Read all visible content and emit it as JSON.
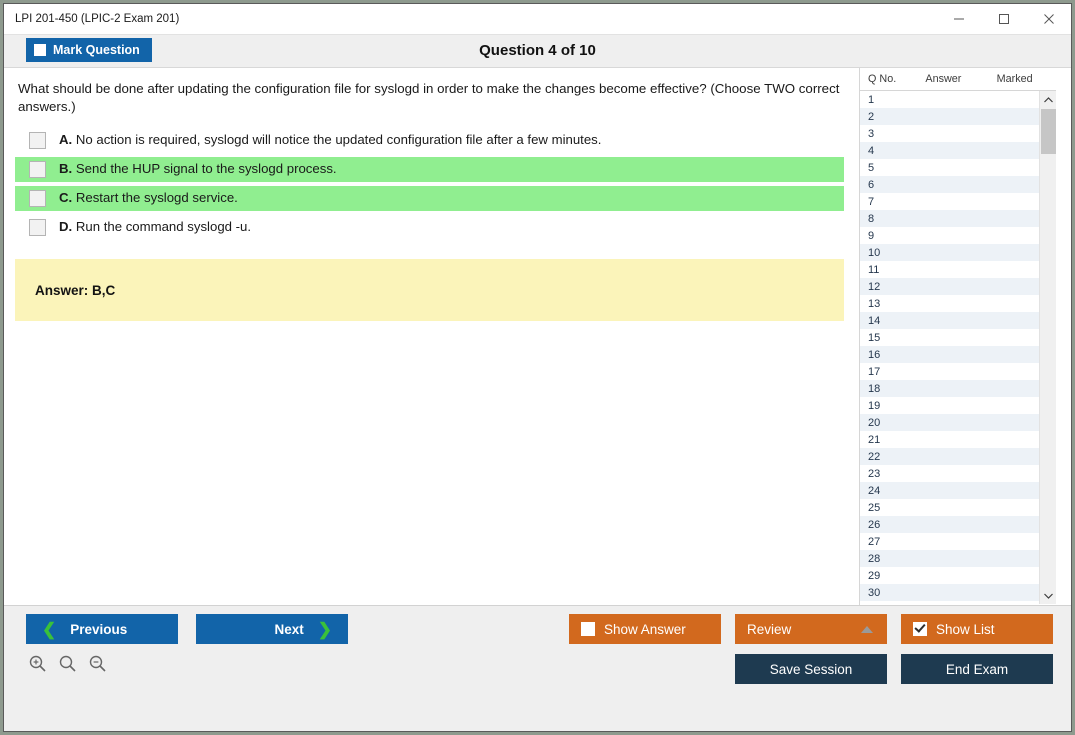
{
  "window": {
    "title": "LPI 201-450 (LPIC-2 Exam 201)",
    "minimize_label": "minimize",
    "maximize_label": "maximize",
    "close_label": "close"
  },
  "toolbar": {
    "mark_question_label": "Mark Question",
    "question_counter": "Question 4 of 10"
  },
  "question": {
    "text": "What should be done after updating the configuration file for syslogd in order to make the changes become effective? (Choose TWO correct answers.)",
    "options": [
      {
        "letter": "A.",
        "text": "No action is required, syslogd will notice the updated configuration file after a few minutes.",
        "correct": false
      },
      {
        "letter": "B.",
        "text": "Send the HUP signal to the syslogd process.",
        "correct": true
      },
      {
        "letter": "C.",
        "text": "Restart the syslogd service.",
        "correct": true
      },
      {
        "letter": "D.",
        "text": "Run the command syslogd -u.",
        "correct": false
      }
    ],
    "answer_label": "Answer: B,C"
  },
  "question_list": {
    "columns": [
      "Q No.",
      "Answer",
      "Marked"
    ],
    "rows": [
      {
        "qno": "1",
        "answer": "",
        "marked": ""
      },
      {
        "qno": "2",
        "answer": "",
        "marked": ""
      },
      {
        "qno": "3",
        "answer": "",
        "marked": ""
      },
      {
        "qno": "4",
        "answer": "",
        "marked": ""
      },
      {
        "qno": "5",
        "answer": "",
        "marked": ""
      },
      {
        "qno": "6",
        "answer": "",
        "marked": ""
      },
      {
        "qno": "7",
        "answer": "",
        "marked": ""
      },
      {
        "qno": "8",
        "answer": "",
        "marked": ""
      },
      {
        "qno": "9",
        "answer": "",
        "marked": ""
      },
      {
        "qno": "10",
        "answer": "",
        "marked": ""
      },
      {
        "qno": "11",
        "answer": "",
        "marked": ""
      },
      {
        "qno": "12",
        "answer": "",
        "marked": ""
      },
      {
        "qno": "13",
        "answer": "",
        "marked": ""
      },
      {
        "qno": "14",
        "answer": "",
        "marked": ""
      },
      {
        "qno": "15",
        "answer": "",
        "marked": ""
      },
      {
        "qno": "16",
        "answer": "",
        "marked": ""
      },
      {
        "qno": "17",
        "answer": "",
        "marked": ""
      },
      {
        "qno": "18",
        "answer": "",
        "marked": ""
      },
      {
        "qno": "19",
        "answer": "",
        "marked": ""
      },
      {
        "qno": "20",
        "answer": "",
        "marked": ""
      },
      {
        "qno": "21",
        "answer": "",
        "marked": ""
      },
      {
        "qno": "22",
        "answer": "",
        "marked": ""
      },
      {
        "qno": "23",
        "answer": "",
        "marked": ""
      },
      {
        "qno": "24",
        "answer": "",
        "marked": ""
      },
      {
        "qno": "25",
        "answer": "",
        "marked": ""
      },
      {
        "qno": "26",
        "answer": "",
        "marked": ""
      },
      {
        "qno": "27",
        "answer": "",
        "marked": ""
      },
      {
        "qno": "28",
        "answer": "",
        "marked": ""
      },
      {
        "qno": "29",
        "answer": "",
        "marked": ""
      },
      {
        "qno": "30",
        "answer": "",
        "marked": ""
      }
    ]
  },
  "footer": {
    "previous_label": "Previous",
    "next_label": "Next",
    "show_answer_label": "Show Answer",
    "show_answer_checked": false,
    "review_label": "Review",
    "show_list_label": "Show List",
    "show_list_checked": true,
    "save_session_label": "Save Session",
    "end_exam_label": "End Exam",
    "zoom_in_icon": "zoom-in-icon",
    "zoom_reset_icon": "zoom-reset-icon",
    "zoom_out_icon": "zoom-out-icon"
  },
  "colors": {
    "accent_blue": "#1264a9",
    "accent_orange": "#d2691e",
    "navy": "#1e3a50",
    "correct_green": "#90ee90",
    "answer_yellow": "#fbf4ba",
    "chevron_green": "#3ac13a"
  }
}
